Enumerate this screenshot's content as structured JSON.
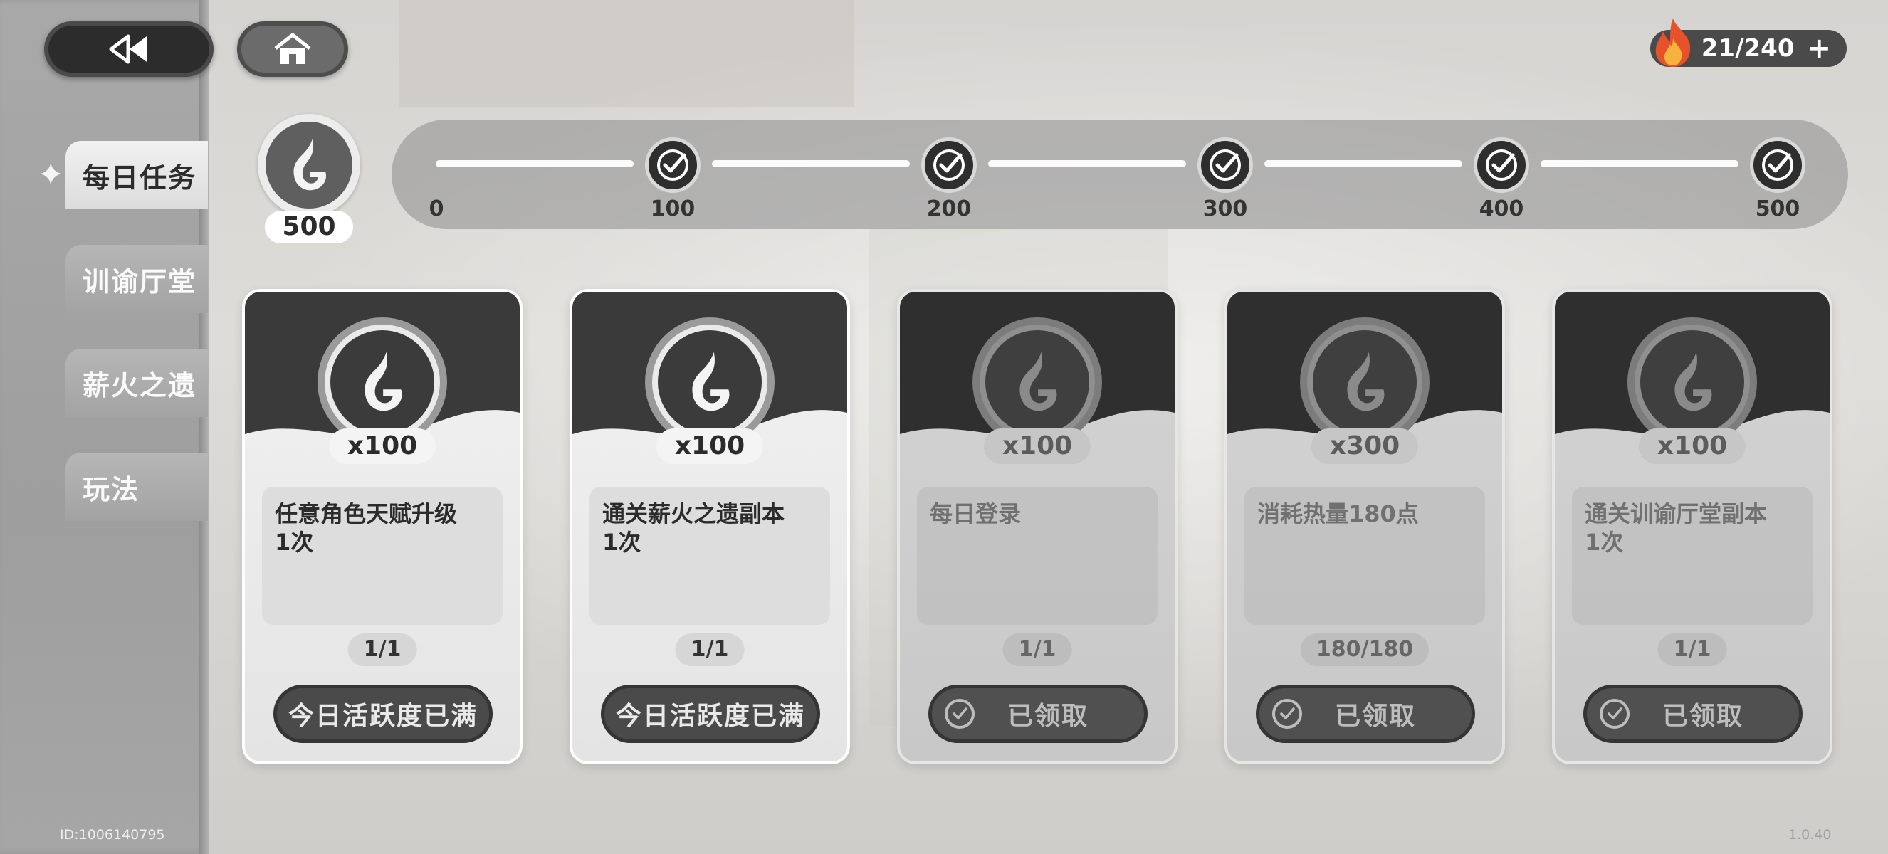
{
  "header": {
    "back_icon": "rewind-icon",
    "home_icon": "home-icon",
    "stamina": {
      "icon": "fire-icon",
      "value": "21/240",
      "plus_label": "+"
    }
  },
  "sidebar": {
    "items": [
      {
        "label": "每日任务",
        "active": true
      },
      {
        "label": "训谕厅堂",
        "active": false
      },
      {
        "label": "薪火之遗",
        "active": false
      },
      {
        "label": "玩法",
        "active": false
      }
    ]
  },
  "activity": {
    "icon": "activity-emblem-icon",
    "current": "500",
    "milestones": [
      {
        "value": "0",
        "claimed": false
      },
      {
        "value": "100",
        "claimed": true
      },
      {
        "value": "200",
        "claimed": true
      },
      {
        "value": "300",
        "claimed": true
      },
      {
        "value": "400",
        "claimed": true
      },
      {
        "value": "500",
        "claimed": true
      }
    ]
  },
  "tasks": [
    {
      "reward": "x100",
      "description": "任意角色天赋升级\n1次",
      "progress": "1/1",
      "button": "今日活跃度已满",
      "state": "full"
    },
    {
      "reward": "x100",
      "description": "通关薪火之遗副本\n1次",
      "progress": "1/1",
      "button": "今日活跃度已满",
      "state": "full"
    },
    {
      "reward": "x100",
      "description": "每日登录",
      "progress": "1/1",
      "button": "已领取",
      "state": "claimed"
    },
    {
      "reward": "x300",
      "description": "消耗热量180点",
      "progress": "180/180",
      "button": "已领取",
      "state": "claimed"
    },
    {
      "reward": "x100",
      "description": "通关训谕厅堂副本\n1次",
      "progress": "1/1",
      "button": "已领取",
      "state": "claimed"
    }
  ],
  "footer": {
    "id_text": "ID:1006140795",
    "version": "1.0.40"
  }
}
